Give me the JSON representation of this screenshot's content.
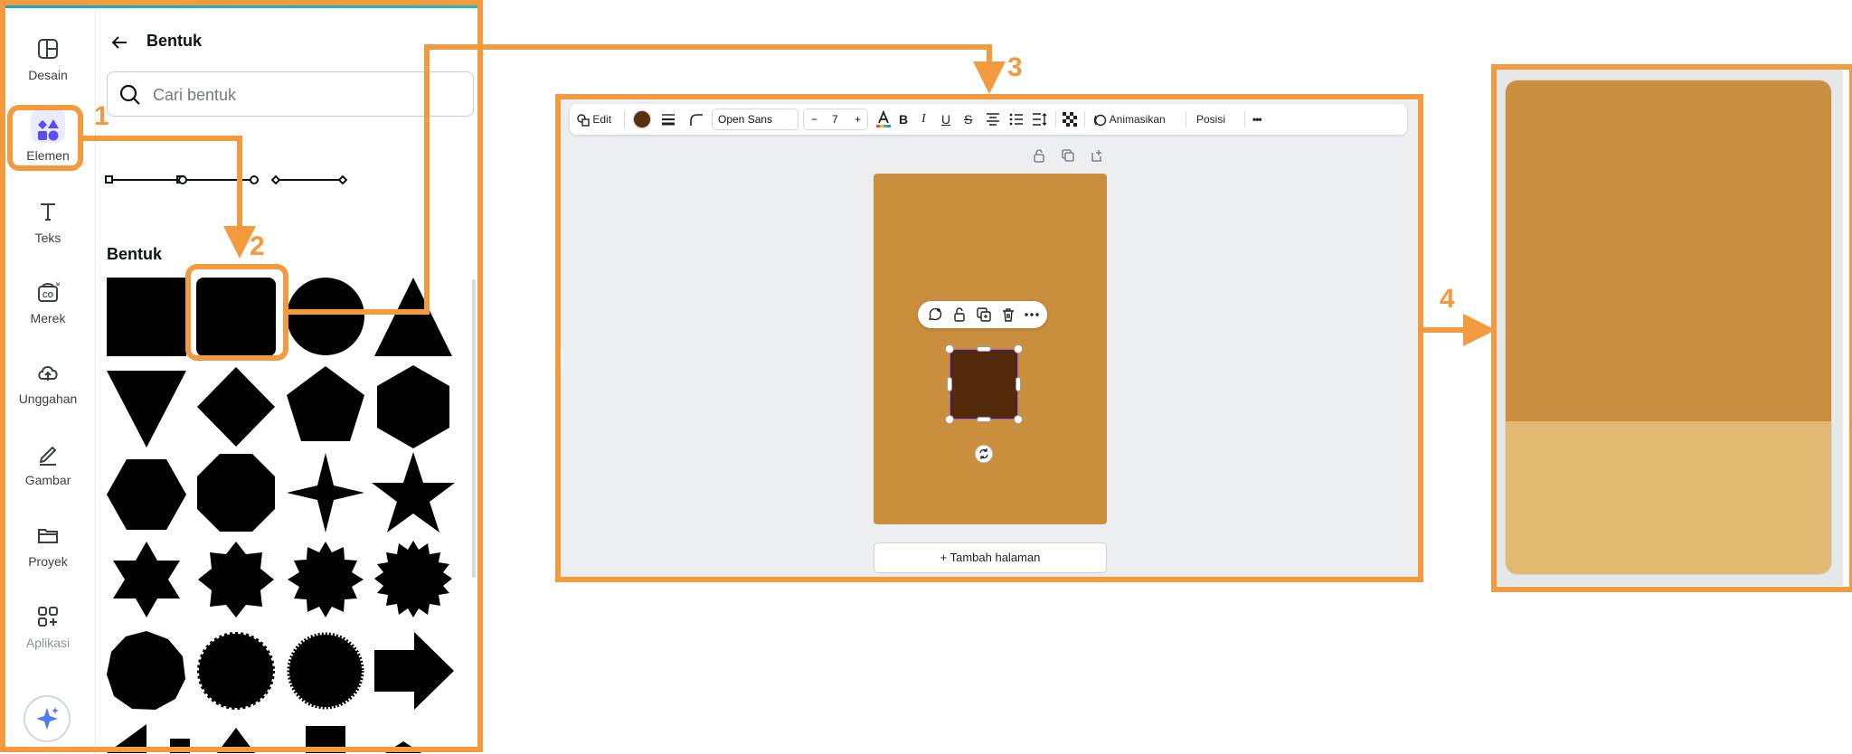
{
  "accent_color": "#f39a3e",
  "annotations": [
    "1",
    "2",
    "3",
    "4"
  ],
  "sidebar": {
    "items": [
      {
        "label": "Desain",
        "icon": "layout-icon"
      },
      {
        "label": "Elemen",
        "icon": "elements-icon",
        "active": true
      },
      {
        "label": "Teks",
        "icon": "text-icon"
      },
      {
        "label": "Merek",
        "icon": "brand-icon"
      },
      {
        "label": "Unggahan",
        "icon": "upload-cloud-icon"
      },
      {
        "label": "Gambar",
        "icon": "draw-icon"
      },
      {
        "label": "Proyek",
        "icon": "folder-icon"
      },
      {
        "label": "Aplikasi",
        "icon": "apps-icon"
      }
    ],
    "magic_icon": "sparkle-icon"
  },
  "library": {
    "title": "Bentuk",
    "search_placeholder": "Cari bentuk",
    "section_title": "Bentuk",
    "lines": [
      "square-end-line",
      "circle-end-line",
      "diamond-end-line"
    ],
    "shapes": [
      "square",
      "rounded-square",
      "circle",
      "triangle",
      "inverted-triangle",
      "diamond",
      "pentagon",
      "hexagon",
      "hexagon-flat",
      "octagon",
      "four-point-star",
      "five-point-star",
      "six-point-star",
      "eight-point-star",
      "twelve-point-star",
      "sixteen-point-star",
      "nonagon-badge",
      "scalloped-badge",
      "serrated-circle",
      "arrow-right"
    ]
  },
  "toolbar": {
    "edit_label": "Edit",
    "fill_color": "#5a300e",
    "font_name": "Open Sans",
    "font_size": "7",
    "minus_label": "−",
    "plus_label": "+",
    "bold_label": "B",
    "italic_label": "I",
    "underline_label": "U",
    "strike_label": "S",
    "animate_label": "Animasikan",
    "position_label": "Posisi",
    "more_label": "•••"
  },
  "canvas": {
    "page_color": "#c98f3d",
    "shape_color": "#532b0a",
    "add_page_label": "+ Tambah halaman"
  },
  "result": {
    "top_color": "#c98f3e",
    "bottom_color": "#e2b973",
    "bottom_fraction": 0.31
  }
}
